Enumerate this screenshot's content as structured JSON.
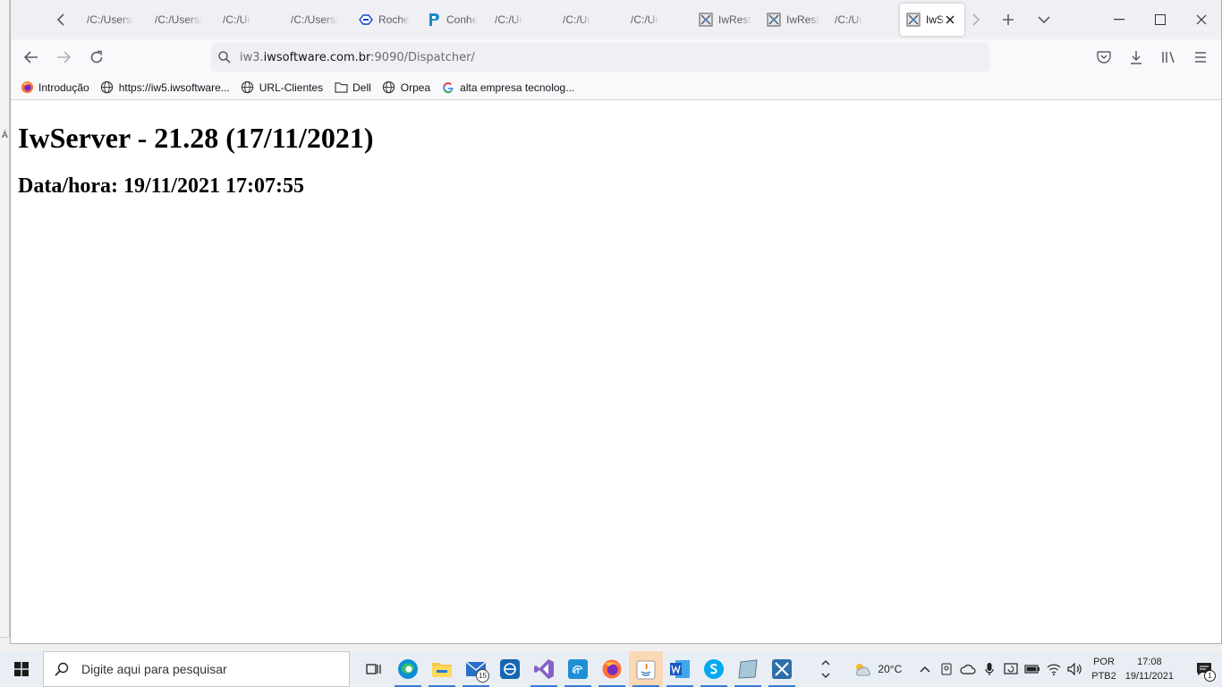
{
  "browser": {
    "tabs": [
      {
        "title": "/C:/Users/",
        "icon": "none"
      },
      {
        "title": "/C:/Users/",
        "icon": "none"
      },
      {
        "title": "/C:/Ur",
        "icon": "none"
      },
      {
        "title": "/C:/Users/",
        "icon": "none"
      },
      {
        "title": "Roche",
        "icon": "roche-logo"
      },
      {
        "title": "Conhe",
        "icon": "confluence-p"
      },
      {
        "title": "/C:/Ur",
        "icon": "none"
      },
      {
        "title": "/C:/Ur",
        "icon": "none"
      },
      {
        "title": "/C:/Ur",
        "icon": "none"
      },
      {
        "title": "IwRest",
        "icon": "network-icon"
      },
      {
        "title": "IwRest",
        "icon": "network-icon"
      },
      {
        "title": "/C:/Ur",
        "icon": "none"
      }
    ],
    "active_tab": {
      "title": "IwS",
      "icon": "network-icon"
    },
    "url": {
      "prefix": "iw3.",
      "domain": "iwsoftware.com.br",
      "rest": ":9090/Dispatcher/"
    },
    "bookmarks": [
      {
        "label": "Introdução",
        "icon": "firefox-icon"
      },
      {
        "label": "https://iw5.iwsoftware...",
        "icon": "globe-icon"
      },
      {
        "label": "URL-Clientes",
        "icon": "globe-icon"
      },
      {
        "label": "Dell",
        "icon": "folder-icon"
      },
      {
        "label": "Orpea",
        "icon": "globe-icon"
      },
      {
        "label": "alta empresa tecnolog...",
        "icon": "google-icon"
      }
    ]
  },
  "page": {
    "title": "IwServer - 21.28 (17/11/2021)",
    "datetime": "Data/hora: 19/11/2021 17:07:55"
  },
  "underlying": {
    "left_mark": "Á"
  },
  "taskbar": {
    "search_placeholder": "Digite aqui para pesquisar",
    "mail_badge": "15",
    "weather": "20°C",
    "lang_top": "POR",
    "lang_bottom": "PTB2",
    "time": "17:08",
    "date": "19/11/2021",
    "notif_count": "1"
  },
  "colors": {
    "accent": "#3a7bd5",
    "tabbar": "#f0f0f4",
    "taskbar": "#e8eef4"
  }
}
